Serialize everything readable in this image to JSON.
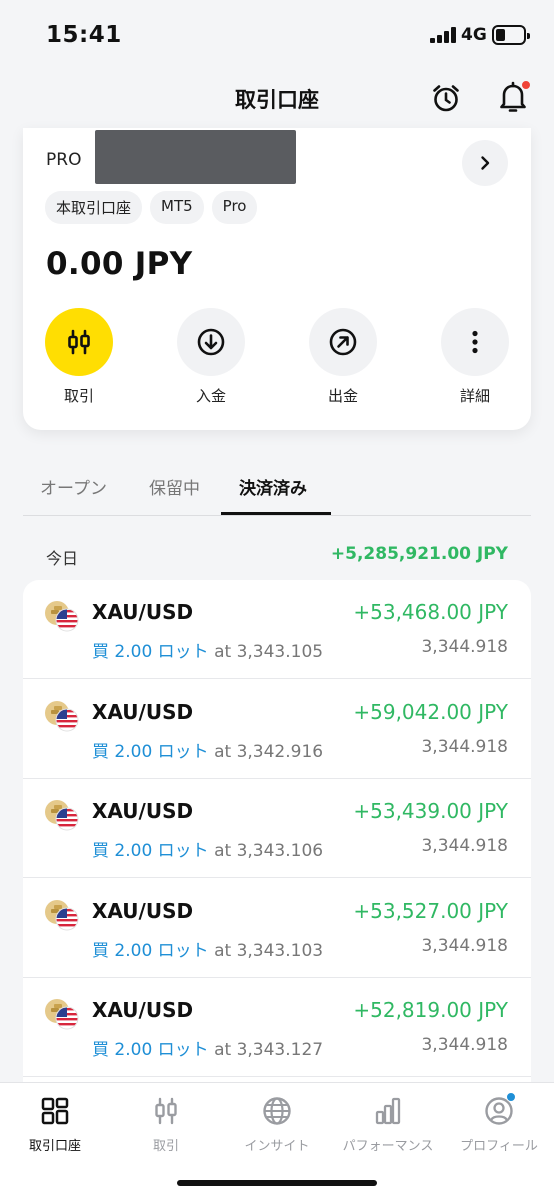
{
  "status_bar": {
    "time": "15:41",
    "network": "4G"
  },
  "header": {
    "title": "取引口座",
    "icons": [
      "alarm-clock-icon",
      "bell-icon"
    ]
  },
  "account": {
    "name_prefix": "PRO",
    "tags": [
      "本取引口座",
      "MT5",
      "Pro"
    ],
    "balance": "0.00 JPY",
    "actions": [
      {
        "label": "取引",
        "icon": "trade-candles-icon"
      },
      {
        "label": "入金",
        "icon": "deposit-down-arrow-icon"
      },
      {
        "label": "出金",
        "icon": "withdraw-up-right-arrow-icon"
      },
      {
        "label": "詳細",
        "icon": "more-vertical-icon"
      }
    ]
  },
  "tabs": [
    {
      "label": "オープン",
      "active": false
    },
    {
      "label": "保留中",
      "active": false
    },
    {
      "label": "決済済み",
      "active": true
    }
  ],
  "day_group": {
    "label": "今日",
    "total": "+5,285,921.00 JPY"
  },
  "trades": [
    {
      "symbol": "XAU/USD",
      "pnl": "+53,468.00 JPY",
      "side": "買 2.00 ロット",
      "open_price": "at 3,343.105",
      "close_price": "3,344.918"
    },
    {
      "symbol": "XAU/USD",
      "pnl": "+59,042.00 JPY",
      "side": "買 2.00 ロット",
      "open_price": "at 3,342.916",
      "close_price": "3,344.918"
    },
    {
      "symbol": "XAU/USD",
      "pnl": "+53,439.00 JPY",
      "side": "買 2.00 ロット",
      "open_price": "at 3,343.106",
      "close_price": "3,344.918"
    },
    {
      "symbol": "XAU/USD",
      "pnl": "+53,527.00 JPY",
      "side": "買 2.00 ロット",
      "open_price": "at 3,343.103",
      "close_price": "3,344.918"
    },
    {
      "symbol": "XAU/USD",
      "pnl": "+52,819.00 JPY",
      "side": "買 2.00 ロット",
      "open_price": "at 3,343.127",
      "close_price": "3,344.918"
    }
  ],
  "bottom_nav": [
    {
      "label": "取引口座",
      "active": true,
      "icon": "accounts-grid-icon"
    },
    {
      "label": "取引",
      "active": false,
      "icon": "trade-candles-icon"
    },
    {
      "label": "インサイト",
      "active": false,
      "icon": "globe-icon"
    },
    {
      "label": "パフォーマンス",
      "active": false,
      "icon": "bar-chart-icon"
    },
    {
      "label": "プロフィール",
      "active": false,
      "icon": "profile-icon",
      "badge": true
    }
  ],
  "colors": {
    "profit": "#30b863",
    "buy": "#1f8fd6",
    "primary_action": "#ffde02",
    "notification_dot": "#f04438"
  }
}
